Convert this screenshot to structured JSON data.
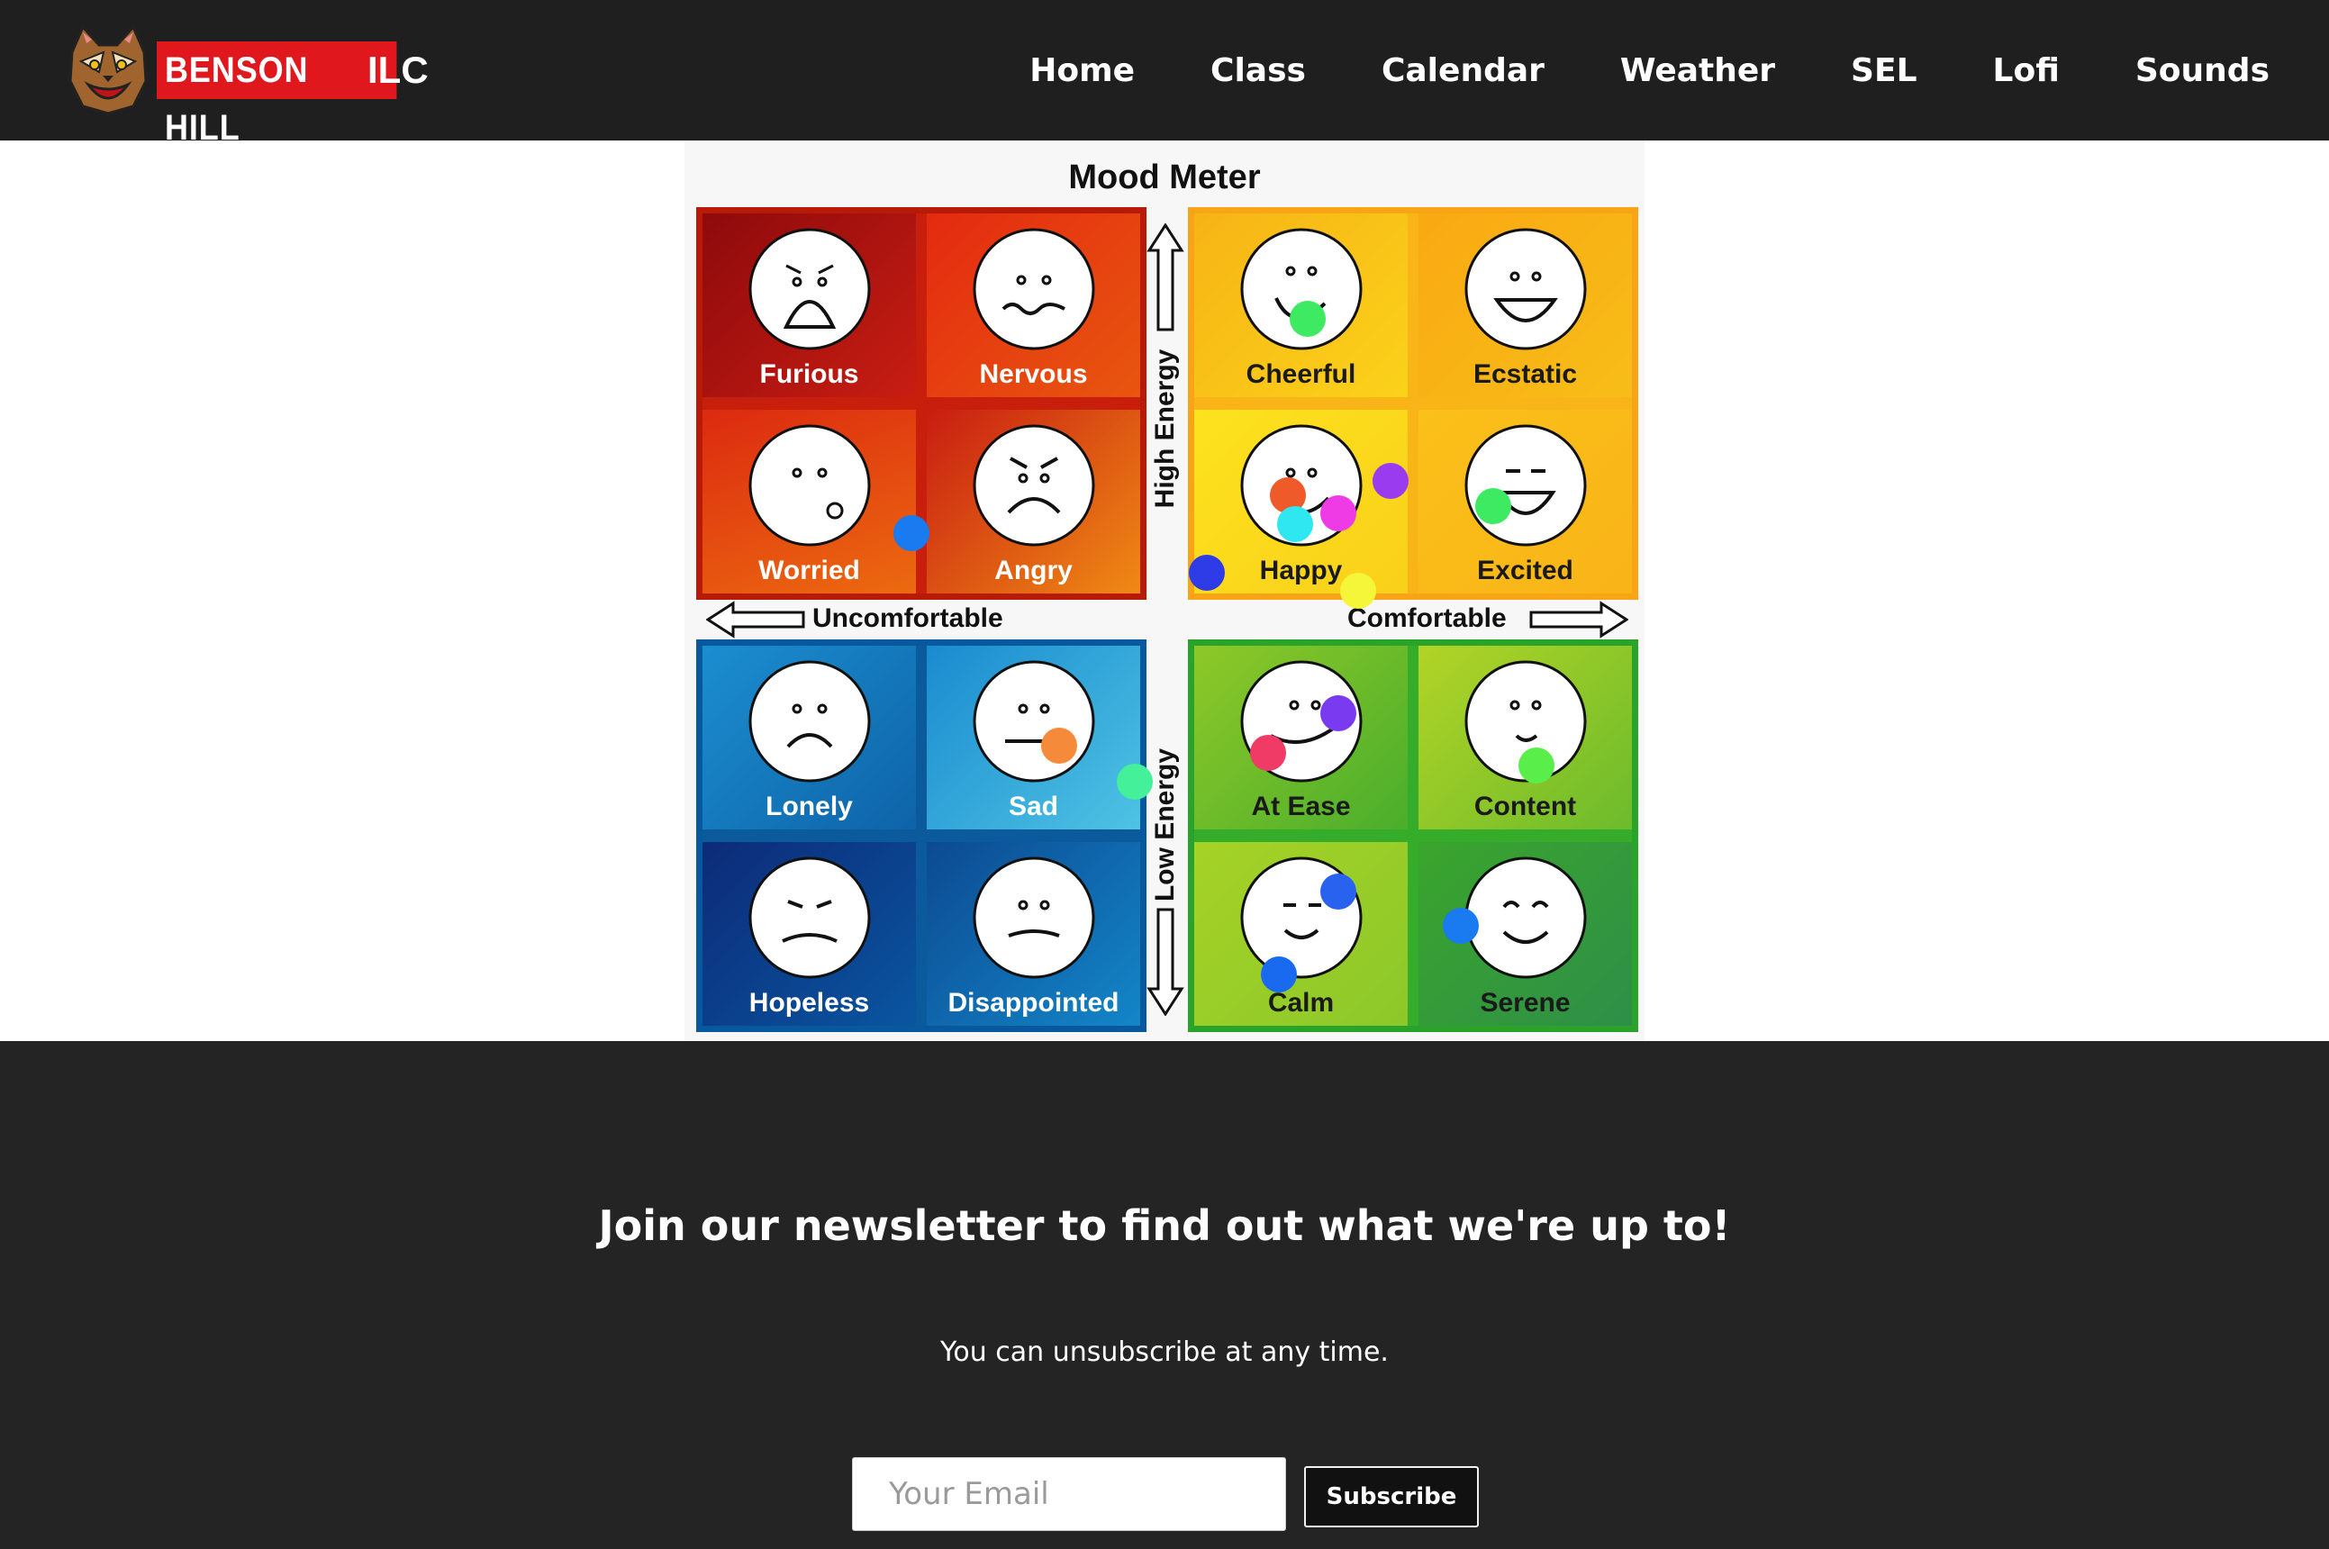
{
  "header": {
    "brand_name": "BENSON HILL",
    "brand_suffix": "ILC",
    "logo_icon": "bobcat-mascot-icon",
    "nav": [
      {
        "label": "Home"
      },
      {
        "label": "Class"
      },
      {
        "label": "Calendar"
      },
      {
        "label": "Weather"
      },
      {
        "label": "SEL"
      },
      {
        "label": "Lofi"
      },
      {
        "label": "Sounds"
      }
    ]
  },
  "mood_meter": {
    "title": "Mood Meter",
    "axis": {
      "high_energy": "High Energy",
      "low_energy": "Low Energy",
      "uncomfortable": "Uncomfortable",
      "comfortable": "Comfortable"
    },
    "quadrants": {
      "red": {
        "color": "#c71f0c",
        "moods": [
          "Furious",
          "Nervous",
          "Worried",
          "Angry"
        ]
      },
      "yellow": {
        "color": "#f9b518",
        "moods": [
          "Cheerful",
          "Ecstatic",
          "Happy",
          "Excited"
        ]
      },
      "blue": {
        "color": "#0a5a9c",
        "moods": [
          "Lonely",
          "Sad",
          "Hopeless",
          "Disappointed"
        ]
      },
      "green": {
        "color": "#36ad2a",
        "moods": [
          "At Ease",
          "Content",
          "Calm",
          "Serene"
        ]
      }
    },
    "markers": [
      {
        "color": "#3dea62"
      },
      {
        "color": "#ef5a2b"
      },
      {
        "color": "#9b3bf0"
      },
      {
        "color": "#2fe7f0"
      },
      {
        "color": "#ee3be6"
      },
      {
        "color": "#2e3ce8"
      },
      {
        "color": "#f5f53a"
      },
      {
        "color": "#3dea62"
      },
      {
        "color": "#1a7af0"
      },
      {
        "color": "#f58a3a"
      },
      {
        "color": "#45f09a"
      },
      {
        "color": "#7a3bf0"
      },
      {
        "color": "#ef3b66"
      },
      {
        "color": "#5aee4a"
      },
      {
        "color": "#2a62f0"
      },
      {
        "color": "#1a7af0"
      },
      {
        "color": "#1a6af0"
      }
    ]
  },
  "footer": {
    "newsletter_title": "Join our newsletter to find out what we're up to!",
    "newsletter_sub": "You can unsubscribe at any time.",
    "email_placeholder": "Your Email",
    "subscribe_label": "Subscribe"
  }
}
